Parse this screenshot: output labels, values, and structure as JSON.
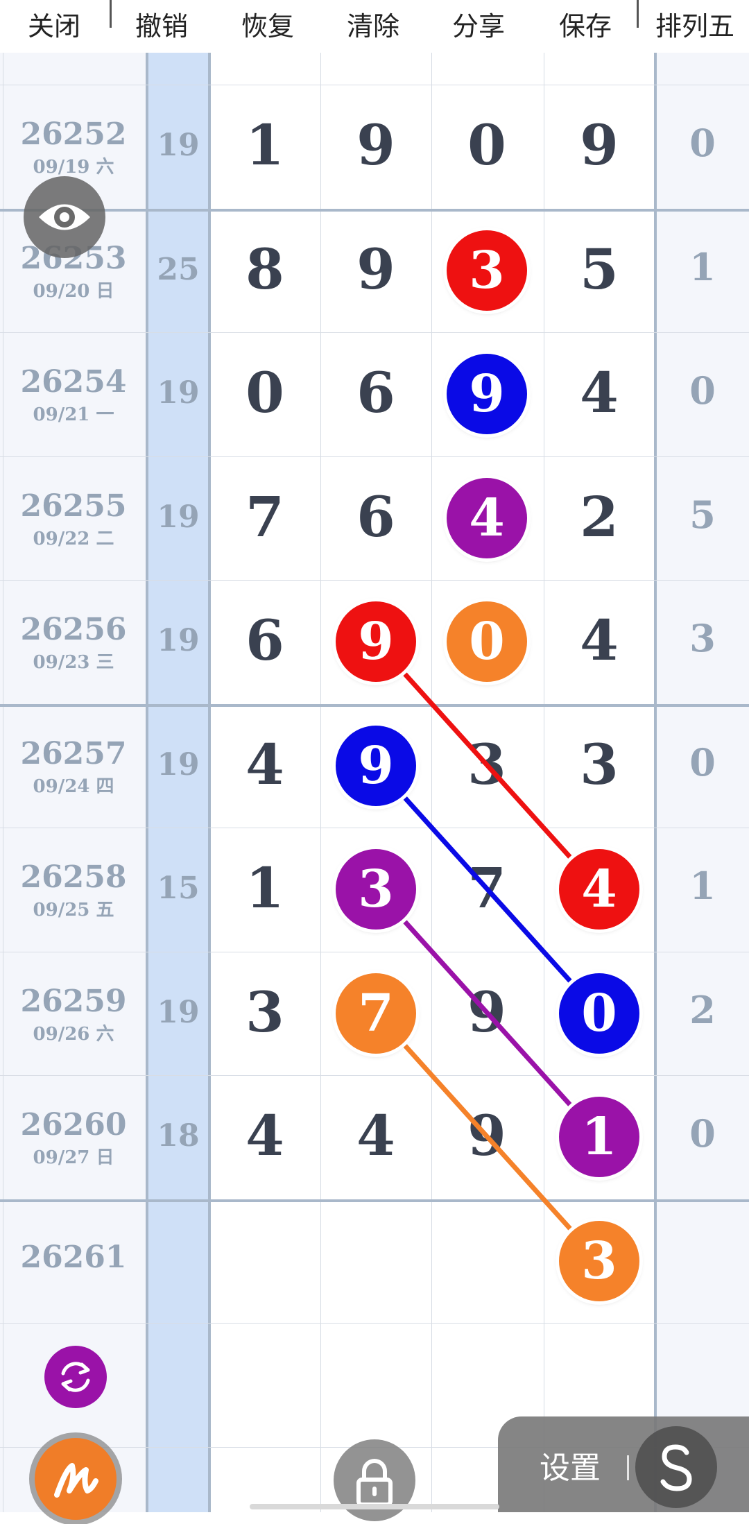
{
  "toolbar": {
    "close": "关闭",
    "undo": "撤销",
    "redo": "恢复",
    "clear": "清除",
    "share": "分享",
    "save": "保存",
    "game": "排列五"
  },
  "rows": [
    {
      "period": "26252",
      "date": "09/19 六",
      "sum": "19",
      "digits": [
        "1",
        "9",
        "0",
        "9"
      ],
      "p5": "0"
    },
    {
      "period": "26253",
      "date": "09/20 日",
      "sum": "25",
      "digits": [
        "8",
        "9",
        "3",
        "5"
      ],
      "p5": "1"
    },
    {
      "period": "26254",
      "date": "09/21 一",
      "sum": "19",
      "digits": [
        "0",
        "6",
        "9",
        "4"
      ],
      "p5": "0"
    },
    {
      "period": "26255",
      "date": "09/22 二",
      "sum": "19",
      "digits": [
        "7",
        "6",
        "4",
        "2"
      ],
      "p5": "5"
    },
    {
      "period": "26256",
      "date": "09/23 三",
      "sum": "19",
      "digits": [
        "6",
        "9",
        "0",
        "4"
      ],
      "p5": "3"
    },
    {
      "period": "26257",
      "date": "09/24 四",
      "sum": "19",
      "digits": [
        "4",
        "9",
        "3",
        "3"
      ],
      "p5": "0"
    },
    {
      "period": "26258",
      "date": "09/25 五",
      "sum": "15",
      "digits": [
        "1",
        "3",
        "7",
        "4"
      ],
      "p5": "1"
    },
    {
      "period": "26259",
      "date": "09/26 六",
      "sum": "19",
      "digits": [
        "3",
        "7",
        "9",
        "0"
      ],
      "p5": "2"
    },
    {
      "period": "26260",
      "date": "09/27 日",
      "sum": "18",
      "digits": [
        "4",
        "4",
        "9",
        "1"
      ],
      "p5": "0"
    },
    {
      "period": "26261",
      "date": "",
      "sum": "",
      "digits": [
        "",
        "",
        "",
        ""
      ],
      "p5": ""
    }
  ],
  "balls": [
    {
      "row": 1,
      "col": 2,
      "color": "#ee1111"
    },
    {
      "row": 2,
      "col": 2,
      "color": "#0a0ae6"
    },
    {
      "row": 3,
      "col": 2,
      "color": "#9a12a8"
    },
    {
      "row": 4,
      "col": 1,
      "color": "#ee1111"
    },
    {
      "row": 4,
      "col": 2,
      "color": "#f5822a"
    },
    {
      "row": 5,
      "col": 1,
      "color": "#0a0ae6"
    },
    {
      "row": 6,
      "col": 1,
      "color": "#9a12a8"
    },
    {
      "row": 6,
      "col": 3,
      "color": "#ee1111"
    },
    {
      "row": 7,
      "col": 1,
      "color": "#f5822a"
    },
    {
      "row": 7,
      "col": 3,
      "color": "#0a0ae6"
    },
    {
      "row": 8,
      "col": 3,
      "color": "#9a12a8"
    },
    {
      "row": 9,
      "col": 3,
      "color": "#f5822a",
      "value": "3"
    }
  ],
  "links": [
    {
      "from": [
        4,
        1
      ],
      "to": [
        6,
        3
      ],
      "color": "#ee1111"
    },
    {
      "from": [
        5,
        1
      ],
      "to": [
        7,
        3
      ],
      "color": "#0a0ae6"
    },
    {
      "from": [
        6,
        1
      ],
      "to": [
        8,
        3
      ],
      "color": "#9a12a8"
    },
    {
      "from": [
        7,
        1
      ],
      "to": [
        9,
        3
      ],
      "color": "#f5822a"
    }
  ],
  "overlays": {
    "eye_icon": "eye-icon",
    "refresh_icon": "refresh-icon",
    "draw_icon": "pen-scribble-icon",
    "lock_icon": "lock-icon",
    "settings_label": "设置",
    "s_icon": "s-logo-icon"
  }
}
